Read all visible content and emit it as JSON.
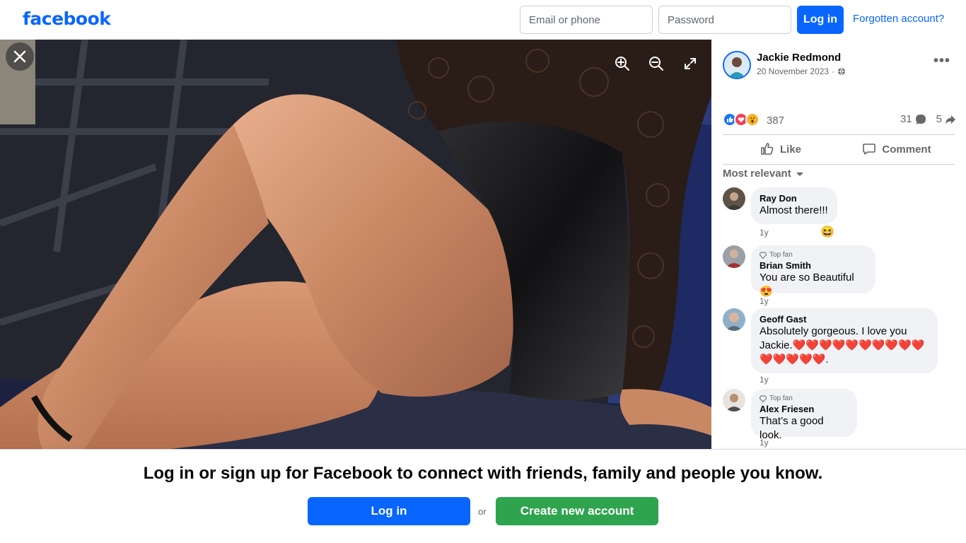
{
  "header": {
    "logo": "facebook",
    "email_placeholder": "Email or phone",
    "password_placeholder": "Password",
    "login_label": "Log in",
    "forgot_label": "Forgotten account?"
  },
  "photo_viewer": {
    "close_icon": "close-icon",
    "zoom_in_icon": "zoom-in-icon",
    "zoom_out_icon": "zoom-out-icon",
    "fullscreen_icon": "fullscreen-icon"
  },
  "post": {
    "author": "Jackie Redmond",
    "date": "20 November 2023",
    "privacy_icon": "globe-icon",
    "reaction_count": "387",
    "comment_count": "31",
    "share_count": "5",
    "like_label": "Like",
    "comment_label": "Comment",
    "filter_label": "Most relevant"
  },
  "comments": [
    {
      "name": "Ray Don",
      "text": "Almost there!!!",
      "time": "1y",
      "badge": "",
      "reaction": "😆"
    },
    {
      "name": "Brian Smith",
      "text": "You are so Beautiful 😍",
      "time": "1y",
      "badge": "Top fan",
      "reaction": ""
    },
    {
      "name": "Geoff Gast",
      "text": "Absolutely gorgeous. I love you Jackie.❤️❤️❤️❤️❤️❤️❤️❤️❤️❤️❤️❤️❤️❤️❤️.",
      "time": "1y",
      "badge": "",
      "reaction": ""
    },
    {
      "name": "Alex Friesen",
      "text": "That’s a good look.",
      "time": "1y",
      "badge": "Top fan",
      "reaction": ""
    }
  ],
  "banner": {
    "title": "Log in or sign up for Facebook to connect with friends, family and people you know.",
    "login_label": "Log in",
    "or_label": "or",
    "create_label": "Create new account"
  },
  "colors": {
    "brand": "#0866ff",
    "create": "#2ea44f"
  }
}
